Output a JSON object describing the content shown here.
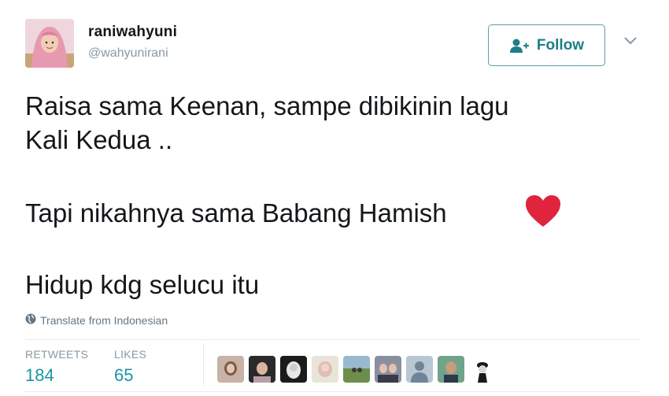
{
  "user": {
    "name": "raniwahyuni",
    "handle": "@wahyunirani"
  },
  "follow": {
    "label": "Follow"
  },
  "tweet": {
    "lines": [
      "Raisa sama Keenan, sampe dibikinin lagu",
      "Kali Kedua ..",
      "Tapi nikahnya sama Babang Hamish",
      "Hidup kdg selucu itu"
    ],
    "emoji": "heart-icon"
  },
  "translate": {
    "label": "Translate from Indonesian"
  },
  "stats": {
    "retweets_label": "RETWEETS",
    "retweets_value": "184",
    "likes_label": "LIKES",
    "likes_value": "65"
  },
  "colors": {
    "accent": "#1b95a6",
    "follow_border": "#5a9ea3",
    "heart": "#e0243d",
    "muted": "#8899a6"
  }
}
